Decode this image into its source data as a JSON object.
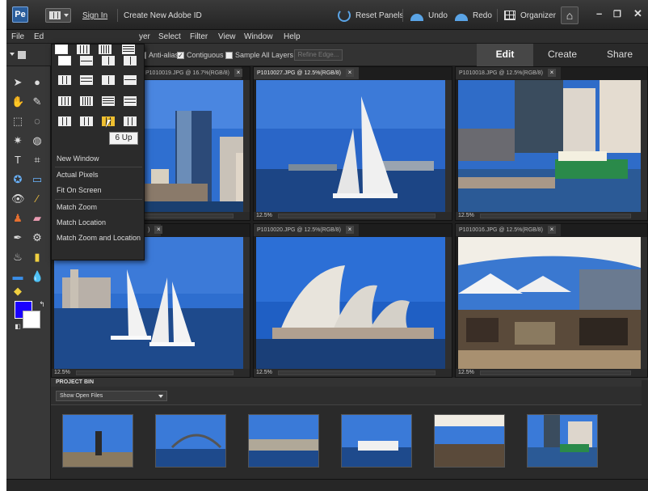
{
  "titlebar": {
    "logo": "Pe",
    "sign_in": "Sign In",
    "create_id": "Create New Adobe ID",
    "reset_panels": "Reset Panels",
    "undo": "Undo",
    "redo": "Redo",
    "organizer": "Organizer",
    "home_icon": "home-icon",
    "minimize": "–",
    "maximize": "❐",
    "close": "✕"
  },
  "menubar": {
    "items": [
      "File",
      "Ed",
      "yer",
      "Select",
      "Filter",
      "View",
      "Window",
      "Help"
    ]
  },
  "options": {
    "anti_alias": "Anti-alias",
    "contiguous": "Contiguous",
    "sample_all": "Sample All Layers",
    "refine_edge": "Refine Edge..."
  },
  "mode_tabs": [
    "Edit",
    "Create",
    "Share"
  ],
  "documents": [
    {
      "tab": "P1010019.JPG @ 16.7%(RGB/8)",
      "zoom": "",
      "active": false
    },
    {
      "tab": "P1010027.JPG @ 12.5%(RGB/8)",
      "zoom": "12.5%",
      "active": true
    },
    {
      "tab": "P1010018.JPG @ 12.5%(RGB/8)",
      "zoom": "12.5%",
      "active": false
    },
    {
      "tab": ")",
      "zoom": "12.5%",
      "active": false
    },
    {
      "tab": "P1010020.JPG @ 12.5%(RGB/8)",
      "zoom": "12.5%",
      "active": false
    },
    {
      "tab": "P1010016.JPG @ 12.5%(RGB/8)",
      "zoom": "12.5%",
      "active": false
    }
  ],
  "layout_menu": {
    "items": [
      "New Window",
      "Actual Pixels",
      "Fit On Screen",
      "Match Zoom",
      "Match Location",
      "Match Zoom and Location"
    ],
    "tooltip": "6 Up"
  },
  "project_bin": {
    "title": "PROJECT BIN",
    "filter": "Show Open Files"
  },
  "colors": {
    "foreground": "#1a00ff",
    "background": "#ffffff"
  }
}
